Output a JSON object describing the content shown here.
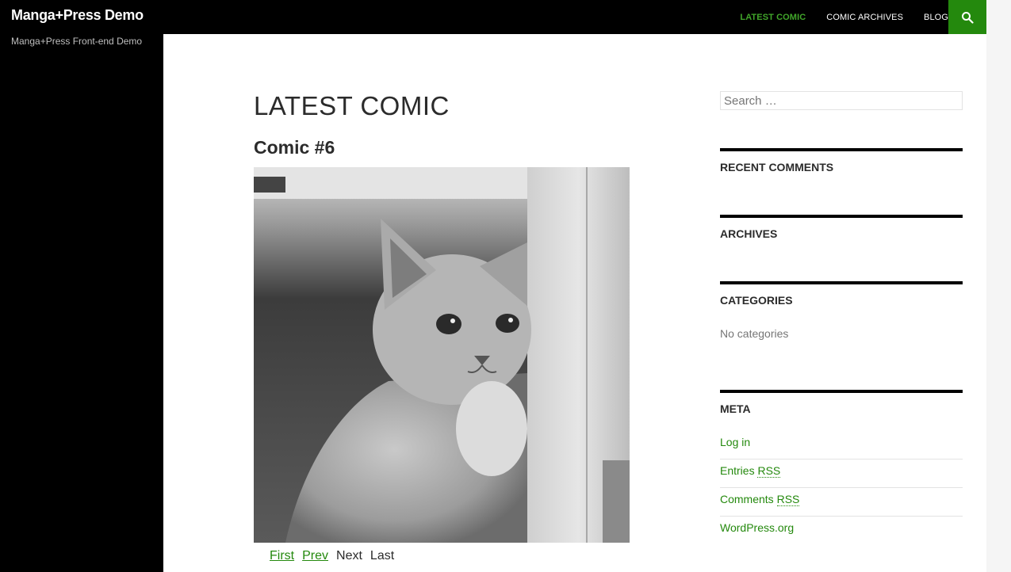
{
  "header": {
    "site_title": "Manga+Press Demo",
    "nav": [
      {
        "label": "LATEST COMIC",
        "active": true
      },
      {
        "label": "COMIC ARCHIVES",
        "active": false
      },
      {
        "label": "BLOG",
        "active": false
      }
    ],
    "search_icon": "search-icon"
  },
  "secondary": {
    "site_description": "Manga+Press Front-end Demo"
  },
  "main": {
    "page_title": "LATEST COMIC",
    "entry_title": "Comic #6",
    "comic_image_alt": "kitten",
    "comic_nav": {
      "first": "First",
      "prev": "Prev",
      "next": "Next",
      "last": "Last"
    }
  },
  "sidebar": {
    "search_placeholder": "Search …",
    "widgets": {
      "recent_comments": "RECENT COMMENTS",
      "archives": "ARCHIVES",
      "categories": "CATEGORIES",
      "categories_text": "No categories",
      "meta": "META"
    },
    "meta_links": {
      "login": "Log in",
      "entries_prefix": "Entries ",
      "comments_prefix": "Comments ",
      "rss": "RSS",
      "wordpress": "WordPress.org"
    }
  },
  "colors": {
    "accent": "#24890d",
    "active_nav": "#41a62a",
    "header_bg": "#000000"
  }
}
